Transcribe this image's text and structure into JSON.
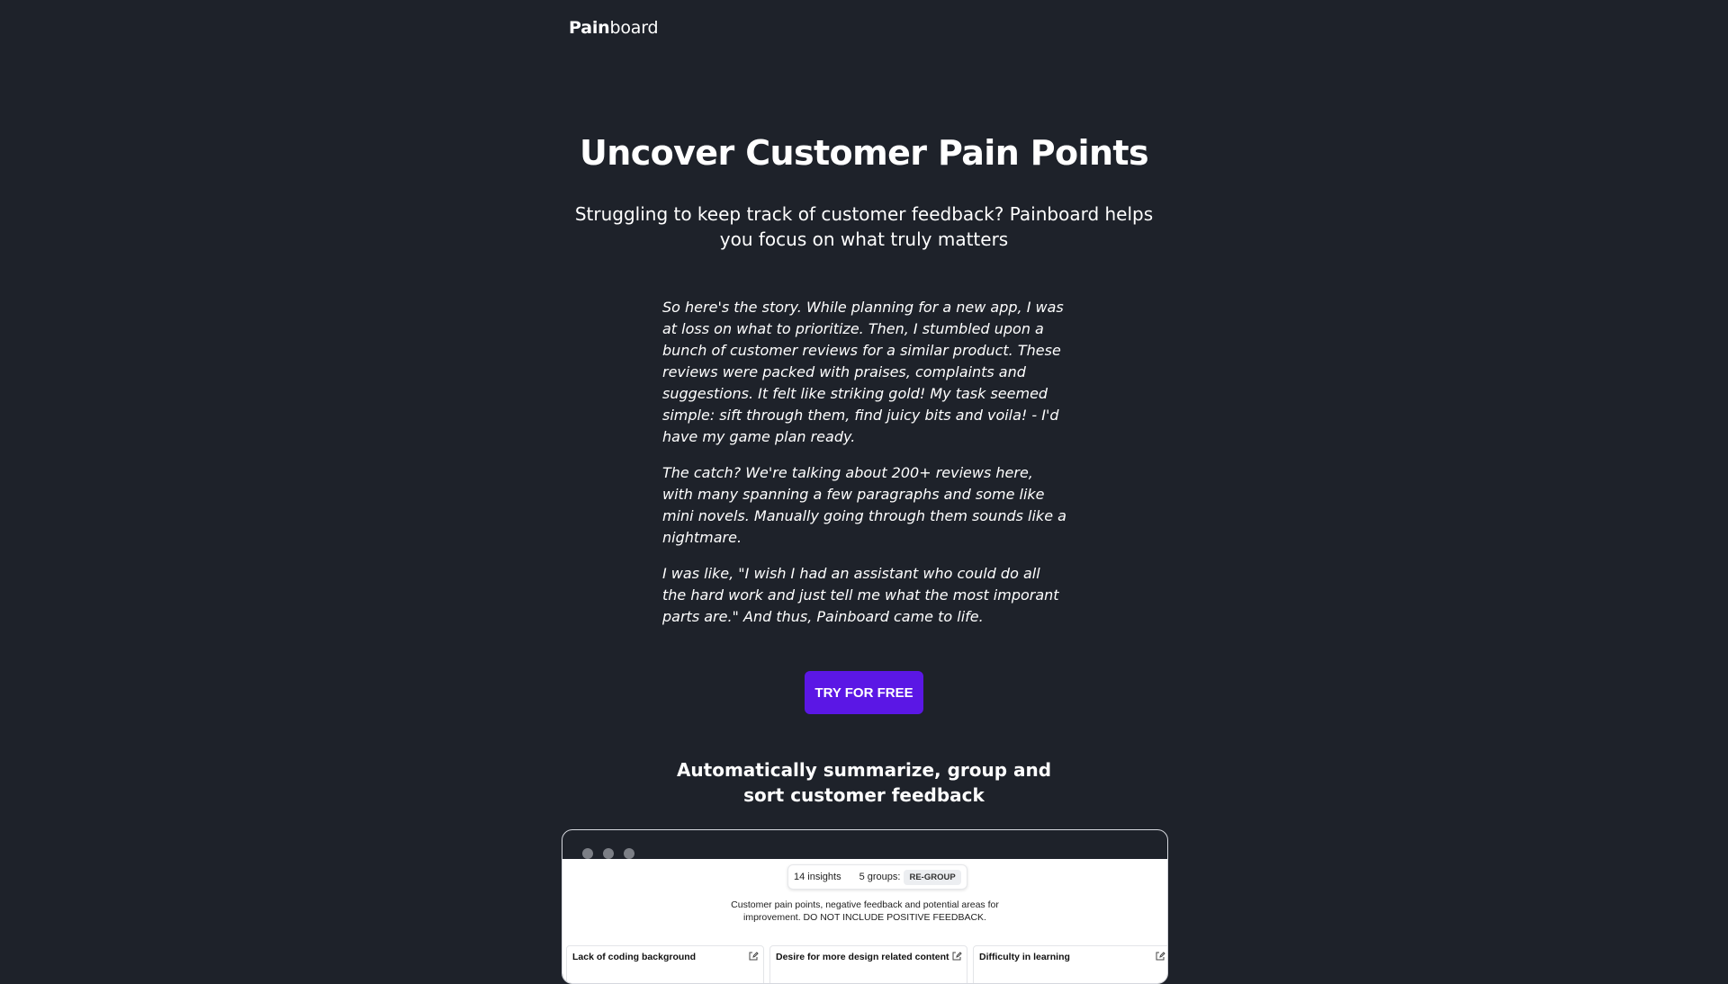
{
  "brand": {
    "bold": "Pain",
    "regular": "board"
  },
  "hero": {
    "title": "Uncover Customer Pain Points",
    "subtitle": "Struggling to keep track of customer feedback? Painboard helps you focus on what truly matters"
  },
  "story": {
    "paragraphs": [
      "So here's the story. While planning for a new app, I was at loss on what to prioritize. Then, I stumbled upon a bunch of customer reviews for a similar product. These reviews were packed with praises, complaints and suggestions. It felt like striking gold! My task seemed simple: sift through them, find juicy bits and voila! - I'd have my game plan ready.",
      "The catch? We're talking about 200+ reviews here, with many spanning a few paragraphs and some like mini novels. Manually going through them sounds like a nightmare.",
      "I was like, \"I wish I had an assistant who could do all the hard work and just tell me what the most imporant parts are.\" And thus, Painboard came to life."
    ]
  },
  "cta": {
    "label": "TRY FOR FREE"
  },
  "features": {
    "title": "Automatically summarize, group and sort customer feedback"
  },
  "preview": {
    "insights_label": "14 insights",
    "groups_label": "5 groups:",
    "regroup_label": "RE-GROUP",
    "prompt": "Customer pain points, negative feedback and potential areas for improvement. DO NOT INCLUDE POSITIVE FEEDBACK.",
    "cards": [
      {
        "title": "Lack of coding background",
        "icon": "edit-icon"
      },
      {
        "title": "Desire for more design related content",
        "icon": "edit-icon"
      },
      {
        "title": "Difficulty in learning",
        "icon": "edit-icon"
      }
    ]
  },
  "colors": {
    "background": "#1e222a",
    "accent": "#5b17e5",
    "window_dot": "#7c7f86"
  }
}
